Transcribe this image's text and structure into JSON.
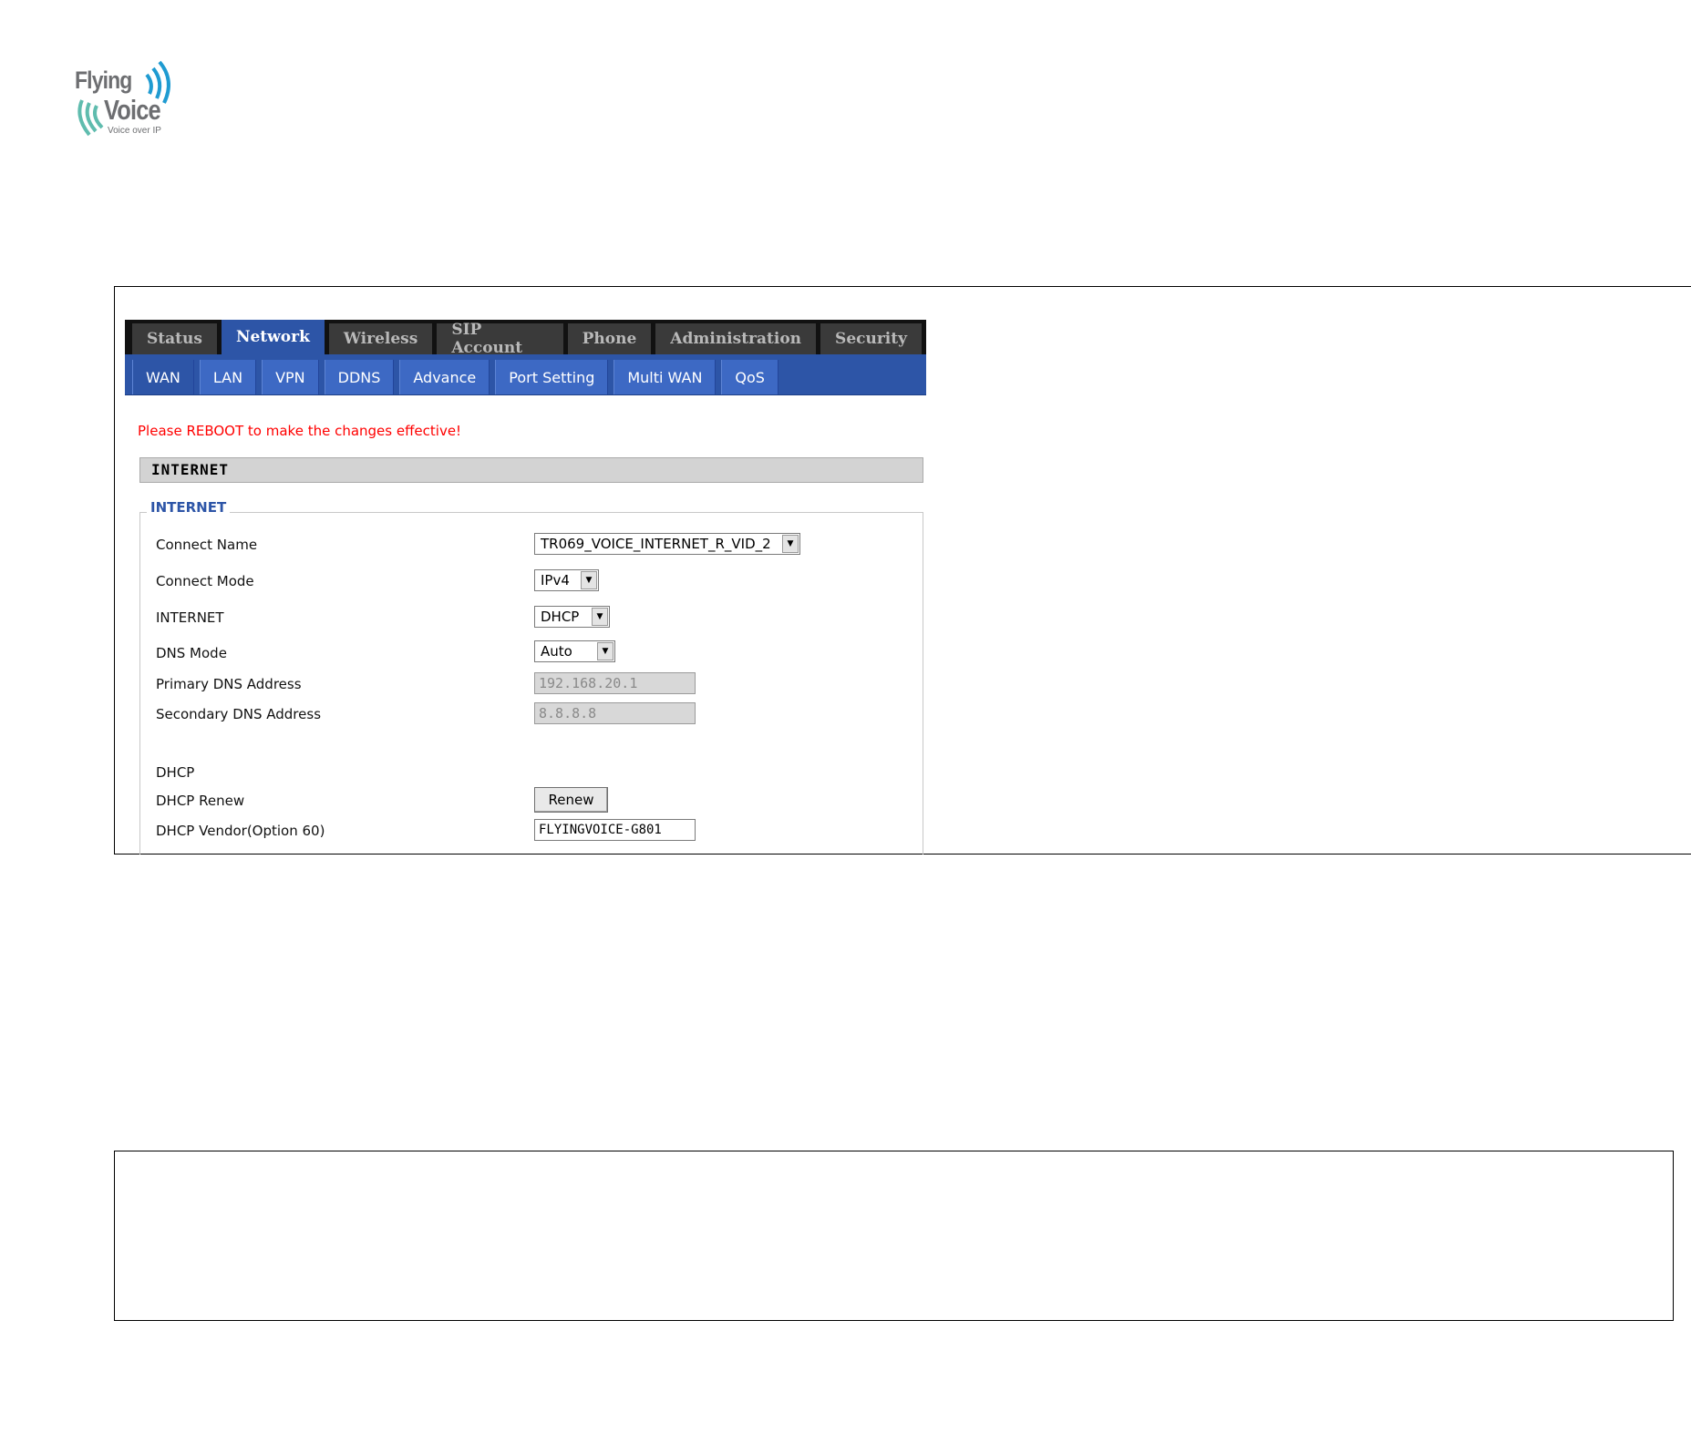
{
  "logo": {
    "line1": "Flying",
    "line2": "Voice",
    "tagline": "Voice over IP"
  },
  "top_tabs": [
    {
      "label": "Status",
      "active": false
    },
    {
      "label": "Network",
      "active": true
    },
    {
      "label": "Wireless",
      "active": false
    },
    {
      "label": "SIP Account",
      "active": false
    },
    {
      "label": "Phone",
      "active": false
    },
    {
      "label": "Administration",
      "active": false
    },
    {
      "label": "Security",
      "active": false
    }
  ],
  "sub_tabs": [
    {
      "label": "WAN",
      "active": true
    },
    {
      "label": "LAN",
      "active": false
    },
    {
      "label": "VPN",
      "active": false
    },
    {
      "label": "DDNS",
      "active": false
    },
    {
      "label": "Advance",
      "active": false
    },
    {
      "label": "Port Setting",
      "active": false
    },
    {
      "label": "Multi WAN",
      "active": false
    },
    {
      "label": "QoS",
      "active": false
    }
  ],
  "notice": "Please REBOOT to make the changes effective!",
  "section_title": "INTERNET",
  "fieldset_legend": "INTERNET",
  "fields": {
    "connect_name": {
      "label": "Connect Name",
      "value": "TR069_VOICE_INTERNET_R_VID_2"
    },
    "connect_mode": {
      "label": "Connect Mode",
      "value": "IPv4"
    },
    "internet": {
      "label": "INTERNET",
      "value": "DHCP"
    },
    "dns_mode": {
      "label": "DNS Mode",
      "value": "Auto"
    },
    "primary_dns": {
      "label": "Primary DNS Address",
      "value": "192.168.20.1"
    },
    "secondary_dns": {
      "label": "Secondary DNS Address",
      "value": "8.8.8.8"
    },
    "dhcp_heading": "DHCP",
    "dhcp_renew": {
      "label": "DHCP Renew",
      "button": "Renew"
    },
    "dhcp_vendor": {
      "label": "DHCP Vendor(Option 60)",
      "value": "FLYINGVOICE-G801"
    }
  }
}
